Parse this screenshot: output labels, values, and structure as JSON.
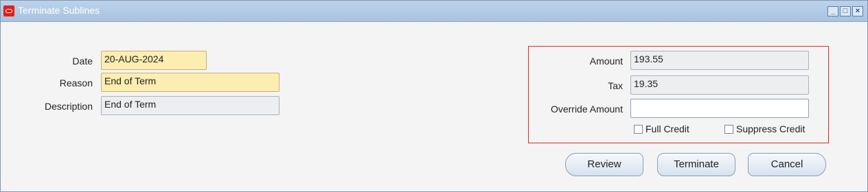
{
  "window": {
    "title": "Terminate Sublines",
    "buttons": [
      "_",
      "□",
      "×"
    ]
  },
  "left": {
    "date_label": "Date",
    "date_value": "20-AUG-2024",
    "reason_label": "Reason",
    "reason_value": "End of Term",
    "description_label": "Description",
    "description_value": "End of Term"
  },
  "right": {
    "amount_label": "Amount",
    "amount_value": "193.55",
    "tax_label": "Tax",
    "tax_value": "19.35",
    "override_label": "Override Amount",
    "override_value": "",
    "full_credit_label": "Full Credit",
    "suppress_credit_label": "Suppress Credit"
  },
  "actions": {
    "review": "Review",
    "terminate": "Terminate",
    "cancel": "Cancel"
  }
}
